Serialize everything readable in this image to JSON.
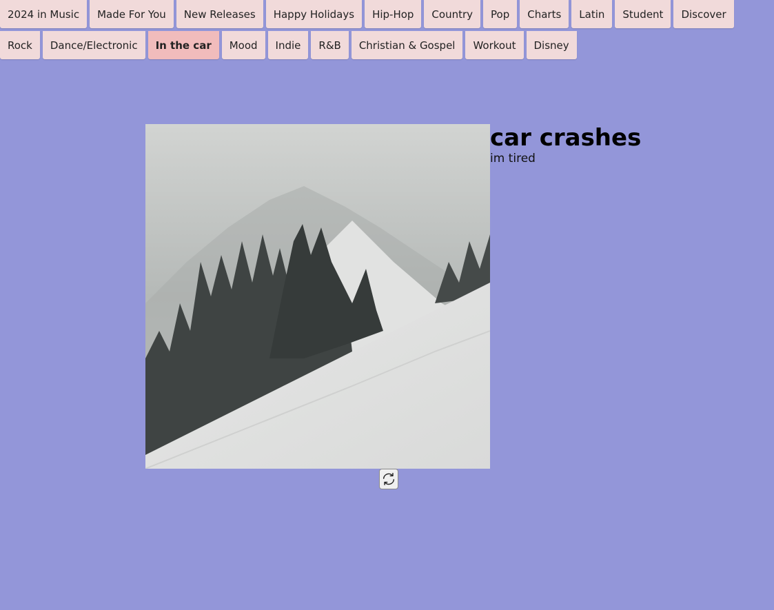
{
  "nav": {
    "tabs": [
      {
        "label": "2024 in Music",
        "active": false
      },
      {
        "label": "Made For You",
        "active": false
      },
      {
        "label": "New Releases",
        "active": false
      },
      {
        "label": "Happy Holidays",
        "active": false
      },
      {
        "label": "Hip-Hop",
        "active": false
      },
      {
        "label": "Country",
        "active": false
      },
      {
        "label": "Pop",
        "active": false
      },
      {
        "label": "Charts",
        "active": false
      },
      {
        "label": "Latin",
        "active": false
      },
      {
        "label": "Student",
        "active": false
      },
      {
        "label": "Discover",
        "active": false
      },
      {
        "label": "Rock",
        "active": false
      },
      {
        "label": "Dance/Electronic",
        "active": false
      },
      {
        "label": "In the car",
        "active": true
      },
      {
        "label": "Mood",
        "active": false
      },
      {
        "label": "Indie",
        "active": false
      },
      {
        "label": "R&B",
        "active": false
      },
      {
        "label": "Christian & Gospel",
        "active": false
      },
      {
        "label": "Workout",
        "active": false
      },
      {
        "label": "Disney",
        "active": false
      }
    ]
  },
  "track": {
    "title": "car crashes",
    "artist": "im tired",
    "artwork_icon": "snowy-mountain-forest-artwork"
  },
  "controls": {
    "refresh_icon": "refresh-icon"
  },
  "colors": {
    "background": "#9396d9",
    "tab": "#f1dada",
    "tab_active": "#f1bcbc"
  }
}
